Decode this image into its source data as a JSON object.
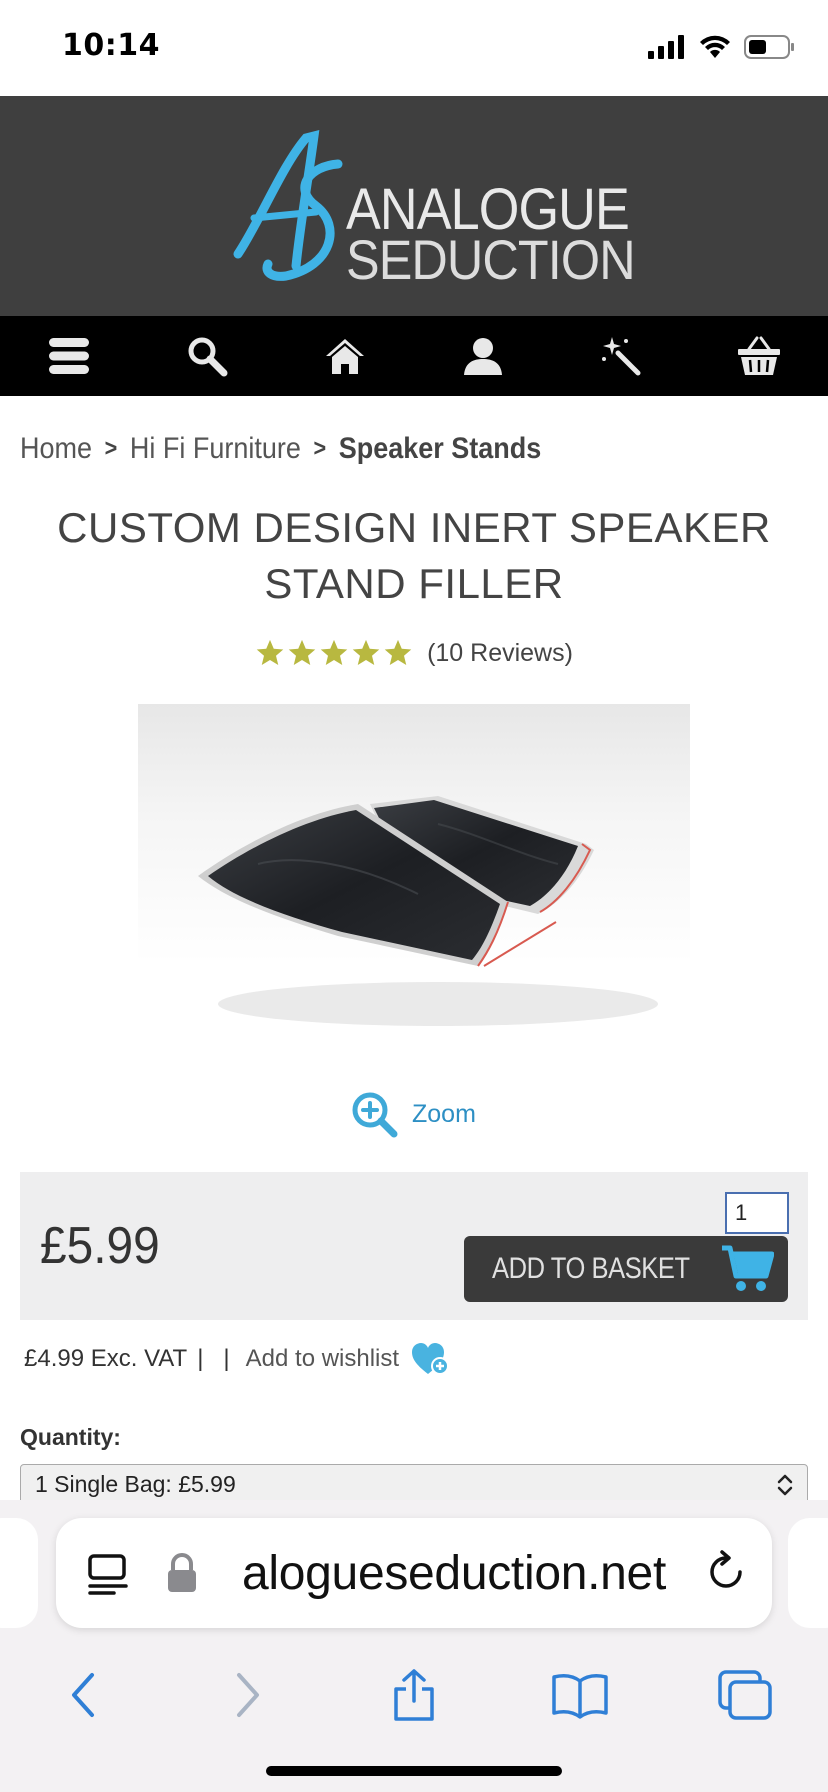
{
  "status_bar": {
    "time": "10:14"
  },
  "header": {
    "logo_line1": "ANALOGUE",
    "logo_line2": "SEDUCTION",
    "brand_color": "#3fb3e6",
    "background": "#3f3f3f"
  },
  "nav": {
    "items": [
      {
        "icon": "menu-icon"
      },
      {
        "icon": "search-icon"
      },
      {
        "icon": "home-icon"
      },
      {
        "icon": "account-icon"
      },
      {
        "icon": "magic-wand-icon"
      },
      {
        "icon": "basket-icon"
      }
    ]
  },
  "breadcrumb": {
    "items": [
      "Home",
      "Hi Fi Furniture",
      "Speaker Stands"
    ],
    "separator": ">"
  },
  "product": {
    "title": "CUSTOM DESIGN INERT SPEAKER STAND FILLER",
    "rating": 5,
    "rating_max": 5,
    "reviews": "(10 Reviews)",
    "star_color": "#b8b840",
    "zoom_label": "Zoom",
    "price": "£5.99",
    "quantity": "1",
    "add_to_basket": "ADD TO BASKET",
    "ex_vat": "£4.99 Exc. VAT",
    "wishlist": "Add to wishlist",
    "quantity_label": "Quantity:",
    "quantity_option": "1 Single Bag:  £5.99"
  },
  "browser": {
    "url": "alogueseduction.net",
    "accent": "#2f7fd6"
  }
}
